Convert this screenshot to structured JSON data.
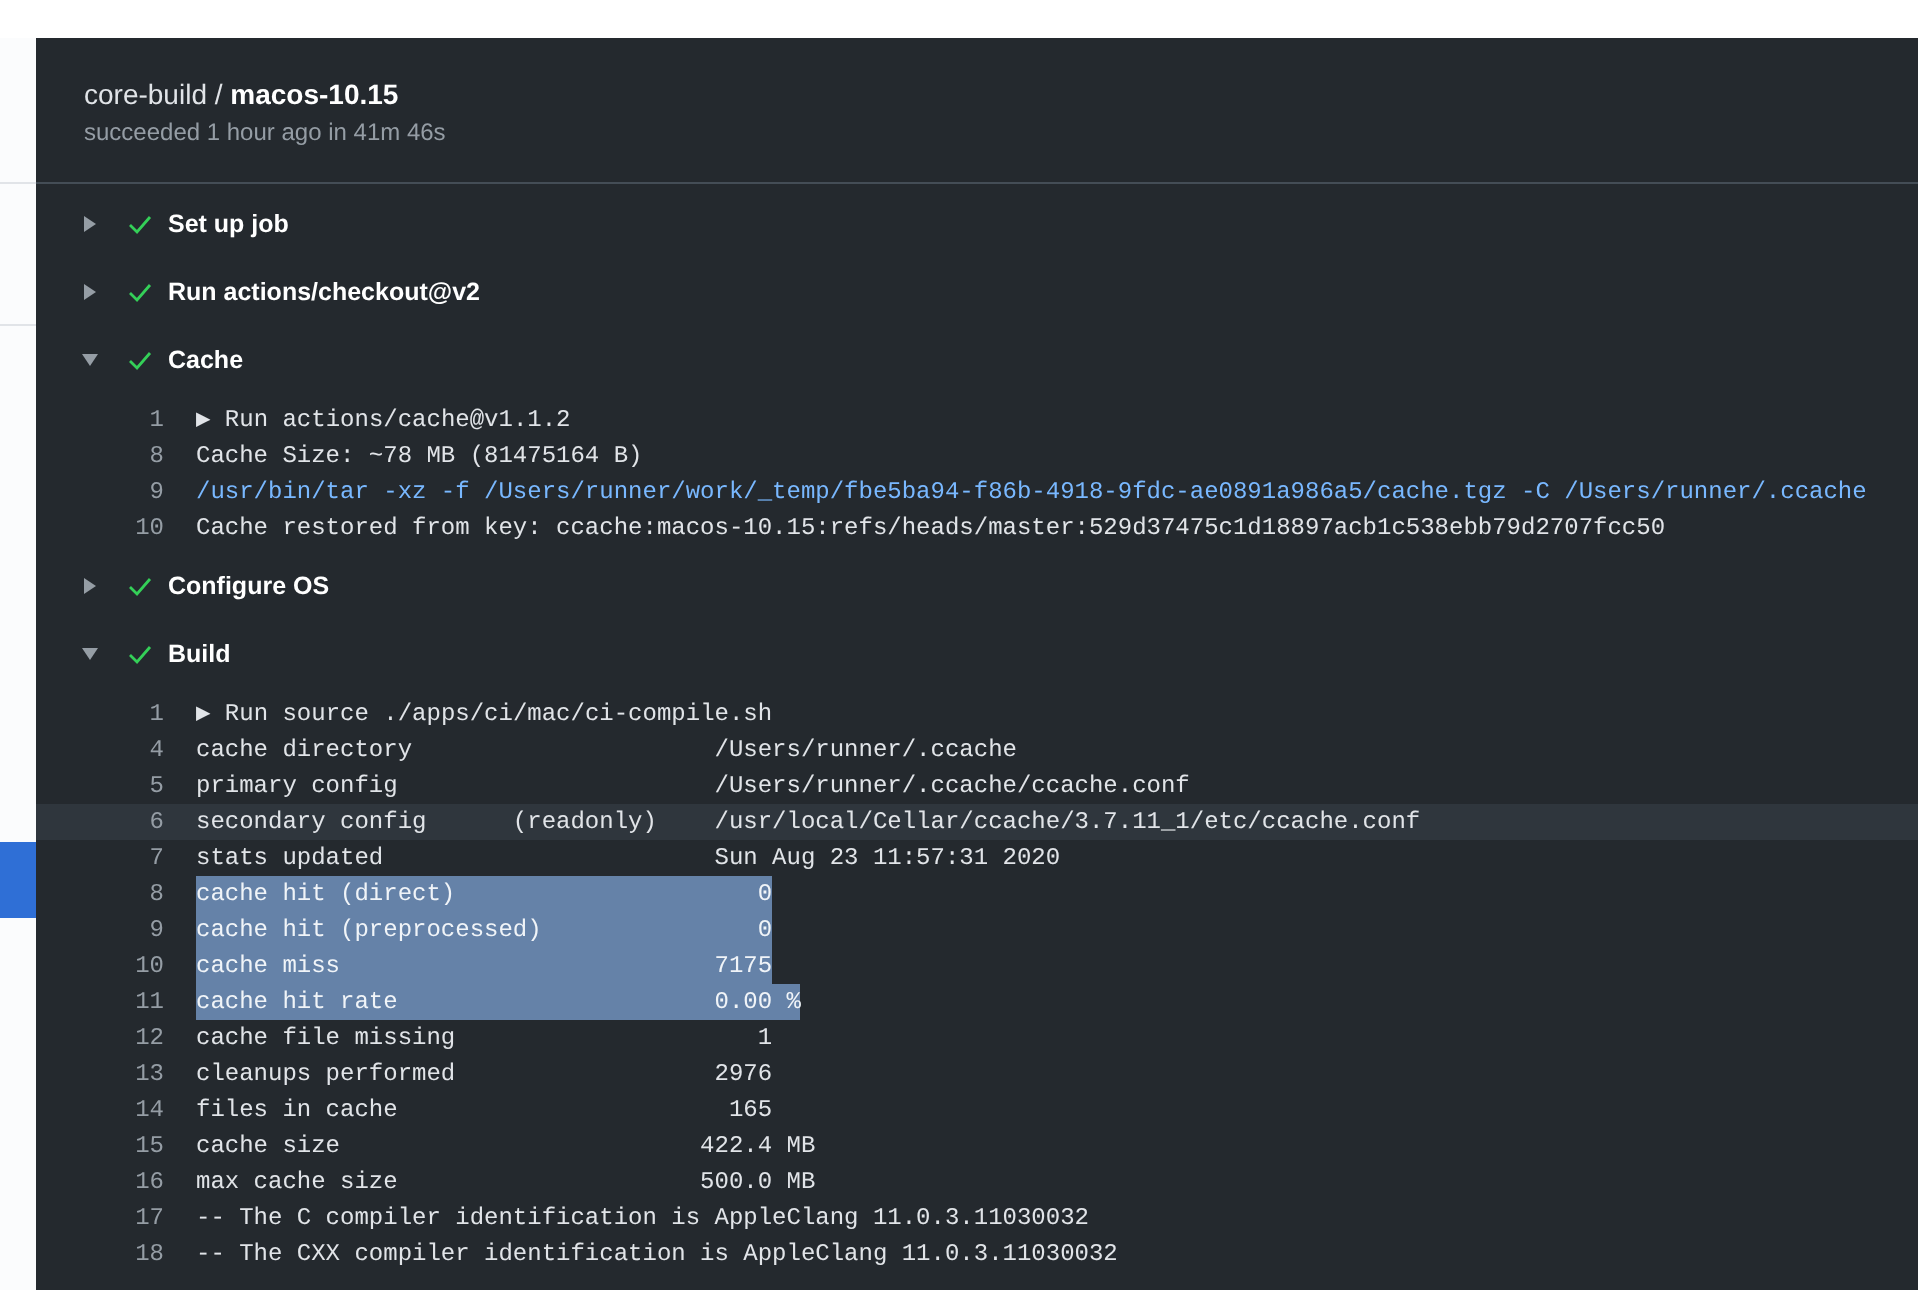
{
  "job": {
    "title": "core-build / **macos-10.15**",
    "status": "succeeded 1 hour ago in 41m 46s"
  },
  "steps": [
    {
      "title": "Set up job",
      "expanded": false,
      "succeeded": true
    },
    {
      "title": "Run actions/checkout@v2",
      "expanded": false,
      "succeeded": true
    },
    {
      "title": "Cache",
      "expanded": true,
      "succeeded": true,
      "lines": [
        {
          "number": "1",
          "text": "▶ Run actions/cache@v1.1.2",
          "kind": "output",
          "selected": false,
          "highlighted": false
        },
        {
          "number": "8",
          "text": "Cache Size: ~78 MB (81475164 B)",
          "kind": "output",
          "selected": false,
          "highlighted": false
        },
        {
          "number": "9",
          "text": "/usr/bin/tar -xz -f /Users/runner/work/_temp/fbe5ba94-f86b-4918-9fdc-ae0891a986a5/cache.tgz -C /Users/runner/.ccache",
          "kind": "command",
          "selected": false,
          "highlighted": false
        },
        {
          "number": "10",
          "text": "Cache restored from key: ccache:macos-10.15:refs/heads/master:529d37475c1d18897acb1c538ebb79d2707fcc50",
          "kind": "output",
          "selected": false,
          "highlighted": false
        }
      ]
    },
    {
      "title": "Configure OS",
      "expanded": false,
      "succeeded": true
    },
    {
      "title": "Build",
      "expanded": true,
      "succeeded": true,
      "lines": [
        {
          "number": "1",
          "text": "▶ Run source ./apps/ci/mac/ci-compile.sh",
          "kind": "output",
          "selected": false,
          "highlighted": false
        },
        {
          "number": "4",
          "text": "cache directory                     /Users/runner/.ccache",
          "kind": "output",
          "selected": false,
          "highlighted": false
        },
        {
          "number": "5",
          "text": "primary config                      /Users/runner/.ccache/ccache.conf",
          "kind": "output",
          "selected": false,
          "highlighted": false
        },
        {
          "number": "6",
          "text": "secondary config      (readonly)    /usr/local/Cellar/ccache/3.7.11_1/etc/ccache.conf",
          "kind": "output",
          "selected": false,
          "highlighted": true
        },
        {
          "number": "7",
          "text": "stats updated                       Sun Aug 23 11:57:31 2020",
          "kind": "output",
          "selected": false,
          "highlighted": false
        },
        {
          "number": "8",
          "text": "cache hit (direct)                     0",
          "kind": "output",
          "selected": true,
          "highlighted": false
        },
        {
          "number": "9",
          "text": "cache hit (preprocessed)               0",
          "kind": "output",
          "selected": true,
          "highlighted": false
        },
        {
          "number": "10",
          "text": "cache miss                          7175",
          "kind": "output",
          "selected": true,
          "highlighted": false
        },
        {
          "number": "11",
          "text": "cache hit rate                      0.00 %",
          "kind": "output",
          "selected": true,
          "highlighted": false
        },
        {
          "number": "12",
          "text": "cache file missing                     1",
          "kind": "output",
          "selected": false,
          "highlighted": false
        },
        {
          "number": "13",
          "text": "cleanups performed                  2976",
          "kind": "output",
          "selected": false,
          "highlighted": false
        },
        {
          "number": "14",
          "text": "files in cache                       165",
          "kind": "output",
          "selected": false,
          "highlighted": false
        },
        {
          "number": "15",
          "text": "cache size                         422.4 MB",
          "kind": "output",
          "selected": false,
          "highlighted": false
        },
        {
          "number": "16",
          "text": "max cache size                     500.0 MB",
          "kind": "output",
          "selected": false,
          "highlighted": false
        },
        {
          "number": "17",
          "text": "-- The C compiler identification is AppleClang 11.0.3.11030032",
          "kind": "output",
          "selected": false,
          "highlighted": false
        },
        {
          "number": "18",
          "text": "-- The CXX compiler identification is AppleClang 11.0.3.11030032",
          "kind": "output",
          "selected": false,
          "highlighted": false
        }
      ]
    }
  ]
}
